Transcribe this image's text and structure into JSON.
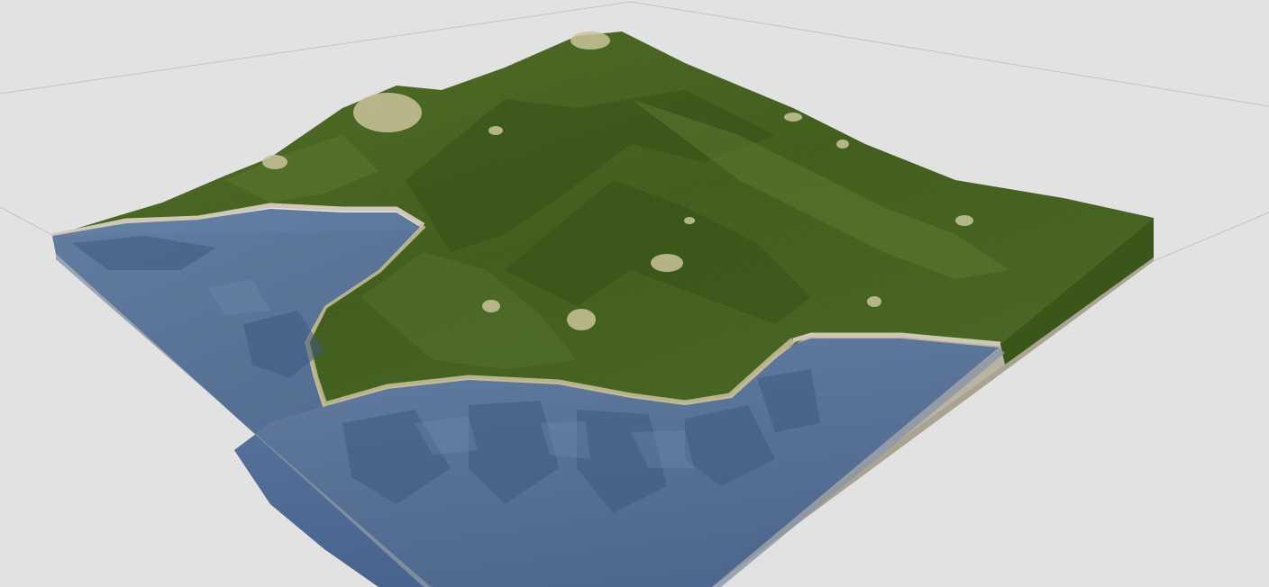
{
  "viewport": {
    "background_color": "#e2e2e2",
    "grid_color": "#c4c4c4"
  },
  "terrain": {
    "land_color": "#4f6f25",
    "land_dark_color": "#3a5618",
    "land_light_color": "#6a8a38",
    "rock_color": "#c9c49a",
    "shore_color": "#cfc8b4",
    "water_color": "#53719a",
    "water_dark_color": "#3f5a80",
    "base_color": "#b9b3a3"
  }
}
